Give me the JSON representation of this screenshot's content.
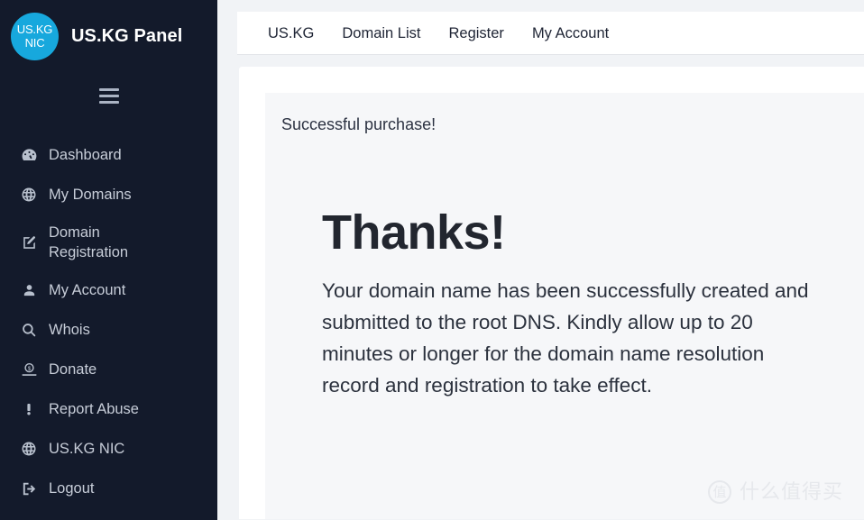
{
  "sidebar": {
    "brand": {
      "logo_line1": "US.KG",
      "logo_line2": "NIC",
      "title": "US.KG Panel",
      "logo_color": "#17a8dd",
      "background_color": "#131a2b"
    },
    "menu_toggle": "hamburger-icon",
    "items": [
      {
        "label": "Dashboard",
        "icon": "dashboard-icon"
      },
      {
        "label": "My Domains",
        "icon": "globe-icon"
      },
      {
        "label": "Domain\nRegistration",
        "icon": "edit-square-icon"
      },
      {
        "label": "My Account",
        "icon": "user-icon"
      },
      {
        "label": "Whois",
        "icon": "search-icon"
      },
      {
        "label": "Donate",
        "icon": "donate-icon"
      },
      {
        "label": "Report Abuse",
        "icon": "exclamation-icon"
      },
      {
        "label": "US.KG NIC",
        "icon": "globe-icon"
      },
      {
        "label": "Logout",
        "icon": "logout-icon"
      }
    ]
  },
  "topnav": {
    "links": [
      {
        "label": "US.KG"
      },
      {
        "label": "Domain List"
      },
      {
        "label": "Register"
      },
      {
        "label": "My Account"
      }
    ]
  },
  "main": {
    "panel_heading": "Successful purchase!",
    "thanks_title": "Thanks!",
    "thanks_body": "Your domain name has been successfully created and submitted to the root DNS. Kindly allow up to 20 minutes or longer for the domain name resolution record and registration to take effect."
  },
  "watermark": {
    "badge": "值",
    "text": "什么值得买"
  }
}
